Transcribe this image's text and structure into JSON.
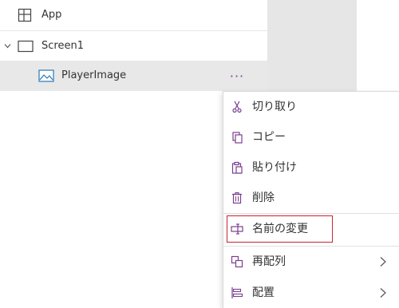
{
  "tree": {
    "items": [
      {
        "label": "App",
        "icon": "app-grid-icon"
      },
      {
        "label": "Screen1",
        "icon": "screen-icon"
      },
      {
        "label": "PlayerImage",
        "icon": "image-icon"
      }
    ],
    "more_label": "···"
  },
  "menu": {
    "items": [
      {
        "label": "切り取り",
        "icon": "cut-icon"
      },
      {
        "label": "コピー",
        "icon": "copy-icon"
      },
      {
        "label": "貼り付け",
        "icon": "paste-icon"
      },
      {
        "label": "削除",
        "icon": "delete-icon"
      },
      {
        "label": "名前の変更",
        "icon": "rename-icon",
        "highlighted": true
      },
      {
        "label": "再配列",
        "icon": "reorder-icon",
        "submenu": true
      },
      {
        "label": "配置",
        "icon": "align-icon",
        "submenu": true
      }
    ]
  },
  "colors": {
    "accent": "#7a3f90",
    "selected_row": "#e8e8e8",
    "highlight_border": "#c4262e",
    "side_strip": "#e6e6e6"
  }
}
